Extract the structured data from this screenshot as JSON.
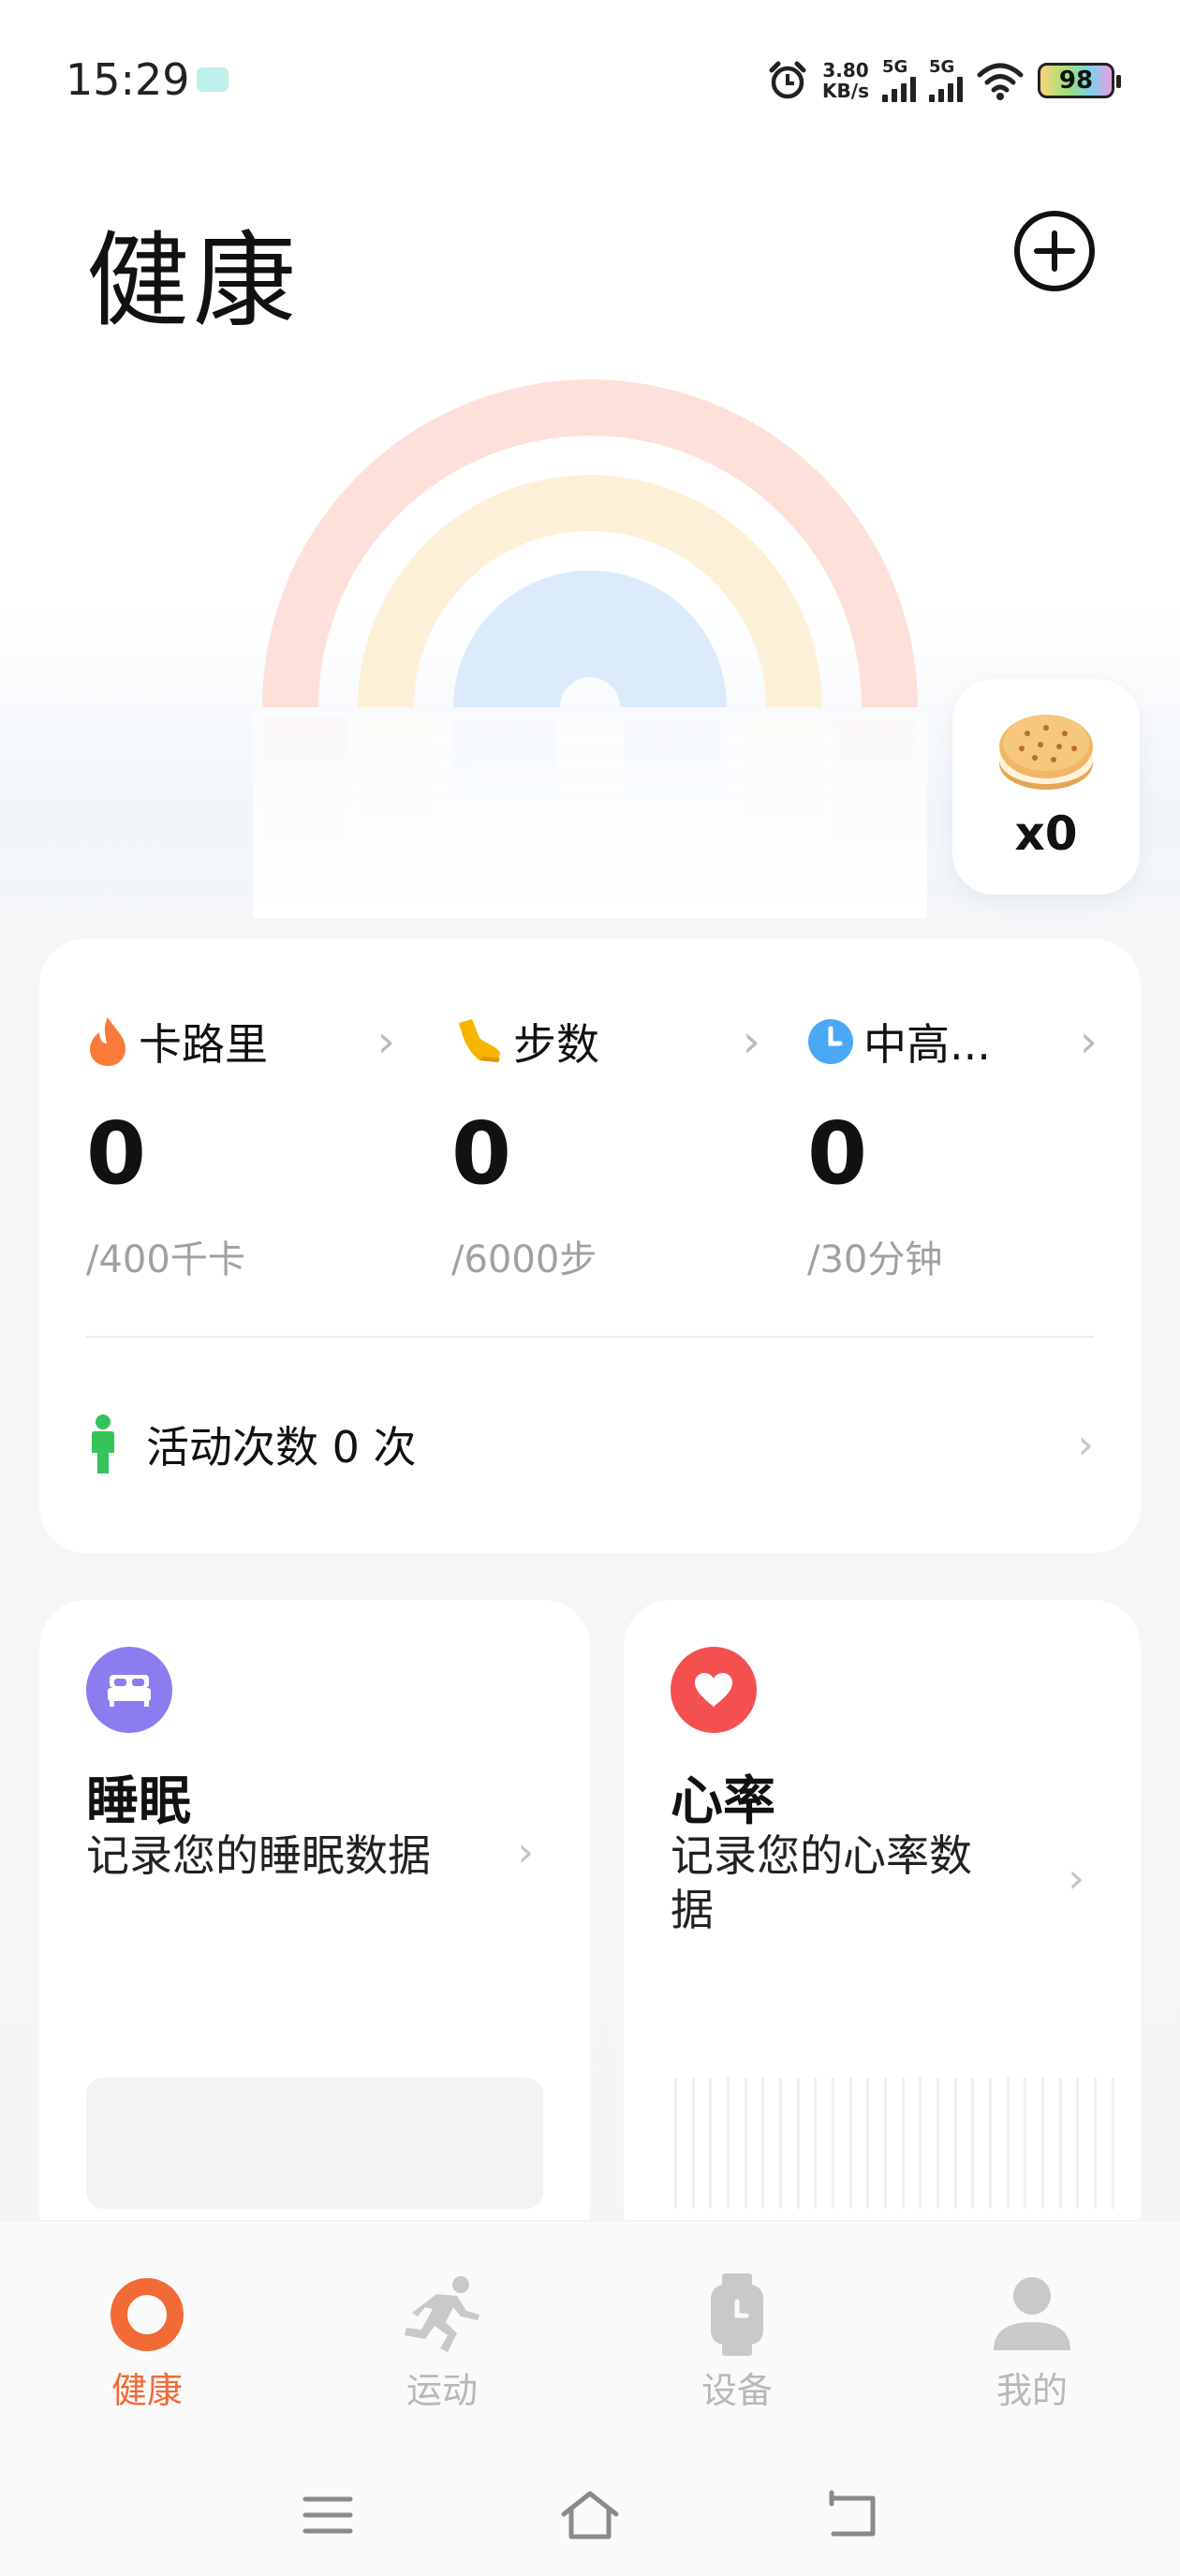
{
  "status_bar": {
    "time": "15:29",
    "net_speed_value": "3.80",
    "net_speed_unit": "KB/s",
    "sim1_label": "5G",
    "sim2_label": "5G",
    "battery_level": "98"
  },
  "header": {
    "title": "健康"
  },
  "rainbow": {
    "colors": [
      "#fde0d9",
      "#fdf0d8",
      "#dcebfb"
    ]
  },
  "cookie": {
    "count_text": "x0"
  },
  "activity": {
    "metrics": [
      {
        "label": "卡路里",
        "value": "0",
        "goal": "/400千卡",
        "icon": "flame-icon",
        "color": "#f97b3a"
      },
      {
        "label": "步数",
        "value": "0",
        "goal": "/6000步",
        "icon": "shoe-icon",
        "color": "#f7b500"
      },
      {
        "label": "中高...",
        "value": "0",
        "goal": "/30分钟",
        "icon": "clock-icon",
        "color": "#4aa8f5"
      }
    ],
    "count_label": "活动次数 0 次"
  },
  "sleep_card": {
    "title": "睡眠",
    "desc": "记录您的睡眠数据",
    "badge_color": "#8b7cf0"
  },
  "heart_card": {
    "title": "心率",
    "desc": "记录您的心率数据",
    "badge_color": "#f45050"
  },
  "bottom_nav": {
    "items": [
      {
        "label": "健康",
        "active": true
      },
      {
        "label": "运动",
        "active": false
      },
      {
        "label": "设备",
        "active": false
      },
      {
        "label": "我的",
        "active": false
      }
    ],
    "accent_color": "#f26a36"
  }
}
